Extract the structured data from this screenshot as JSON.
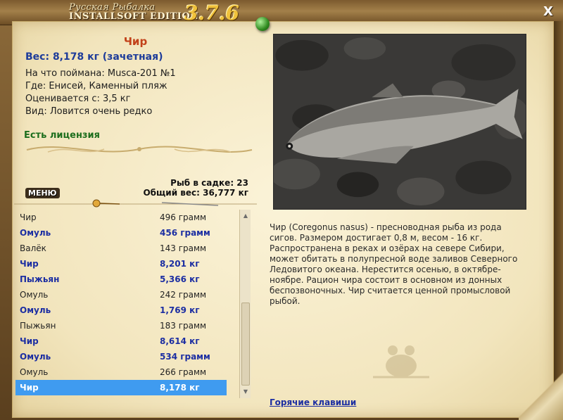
{
  "window": {
    "brand_top": "Русская Рыбалка",
    "brand_bottom": "INSTALLSOFT EDITION",
    "version": "3.7.6",
    "close_label": "X"
  },
  "fish": {
    "title": "Чир",
    "weight_line": "Вес: 8,178 кг (зачетная)",
    "bait_line": "На что поймана: Musca-201 №1",
    "place_line": "Где: Енисей, Каменный пляж",
    "rated_line": "Оценивается с: 3,5 кг",
    "kind_line": "Вид: Ловится очень редко",
    "license": "Есть лицензия",
    "description": "Чир (Coregonus nasus) - пресноводная рыба из рода сигов. Размером достигает 0,8 м, весом - 16 кг. Распространена в реках и озёрах на севере Сибири, может обитать в полупресной воде заливов Северного Ледовитого океана. Нерестится осенью, в октябре-ноябре. Рацион чира состоит в основном из донных беспозвоночных. Чир считается ценной промысловой рыбой."
  },
  "keepnet": {
    "count_line": "Рыб в садке: 23",
    "total_line": "Общий вес: 36,777 кг"
  },
  "menu_label": "МЕНЮ",
  "hotkeys_label": "Горячие клавиши",
  "catch_list": [
    {
      "name": "Чир",
      "weight": "496 грамм",
      "style": "plain"
    },
    {
      "name": "Омуль",
      "weight": "456 грамм",
      "style": "bold"
    },
    {
      "name": "Валёк",
      "weight": "143 грамм",
      "style": "plain"
    },
    {
      "name": "Чир",
      "weight": "8,201 кг",
      "style": "bold"
    },
    {
      "name": "Пыжьян",
      "weight": "5,366 кг",
      "style": "bold"
    },
    {
      "name": "Омуль",
      "weight": "242 грамм",
      "style": "plain"
    },
    {
      "name": "Омуль",
      "weight": "1,769 кг",
      "style": "bold"
    },
    {
      "name": "Пыжьян",
      "weight": "183 грамм",
      "style": "plain"
    },
    {
      "name": "Чир",
      "weight": "8,614 кг",
      "style": "bold"
    },
    {
      "name": "Омуль",
      "weight": "534 грамм",
      "style": "bold"
    },
    {
      "name": "Омуль",
      "weight": "266 грамм",
      "style": "plain"
    },
    {
      "name": "Чир",
      "weight": "8,178 кг",
      "style": "selected"
    }
  ],
  "colors": {
    "title_orange": "#c2411a",
    "list_bold_blue": "#1c2ea2",
    "selection_blue": "#3f9bf0",
    "license_green": "#1d6e1d"
  }
}
